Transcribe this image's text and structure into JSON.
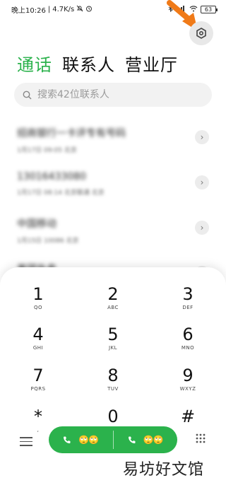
{
  "status_bar": {
    "time": "晚上10:26",
    "speed": "4.7K/s",
    "battery": "63"
  },
  "tabs": [
    {
      "label": "通话",
      "active": true
    },
    {
      "label": "联系人",
      "active": false
    },
    {
      "label": "营业厅",
      "active": false
    }
  ],
  "search": {
    "placeholder": "搜索42位联系人"
  },
  "call_log": [
    {
      "name": "招商银行一卡评专有号码",
      "sub": "1月17日 09:05 北京",
      "blurred": true
    },
    {
      "name": "13016433080",
      "sub": "1月17日 08:14 北京联通 北京",
      "blurred": true
    },
    {
      "name": "中国移动",
      "sub": "1月15日 10086 北京",
      "blurred": true
    },
    {
      "name": "美团外卖",
      "sub": "",
      "blurred": true
    }
  ],
  "dialpad": {
    "keys": [
      {
        "digit": "1",
        "letters": "QO"
      },
      {
        "digit": "2",
        "letters": "ABC"
      },
      {
        "digit": "3",
        "letters": "DEF"
      },
      {
        "digit": "4",
        "letters": "GHI"
      },
      {
        "digit": "5",
        "letters": "JKL"
      },
      {
        "digit": "6",
        "letters": "MNO"
      },
      {
        "digit": "7",
        "letters": "PQRS"
      },
      {
        "digit": "8",
        "letters": "TUV"
      },
      {
        "digit": "9",
        "letters": "WXYZ"
      },
      {
        "digit": "*",
        "letters": ","
      },
      {
        "digit": "0",
        "letters": "+"
      },
      {
        "digit": "#",
        "letters": ""
      }
    ]
  },
  "call_bar": {
    "sim1_emoji": "🙄🙄",
    "sim2_emoji": "🙄🙄",
    "accent_color": "#2bb24c"
  },
  "watermark": "易坊好文馆",
  "icons": [
    "silent-icon",
    "alarm-icon",
    "bluetooth-icon",
    "wifi-icon",
    "signal-icon",
    "gear-icon",
    "search-icon",
    "chevron-right-icon",
    "menu-icon",
    "phone-icon",
    "dialpad-grid-icon"
  ]
}
